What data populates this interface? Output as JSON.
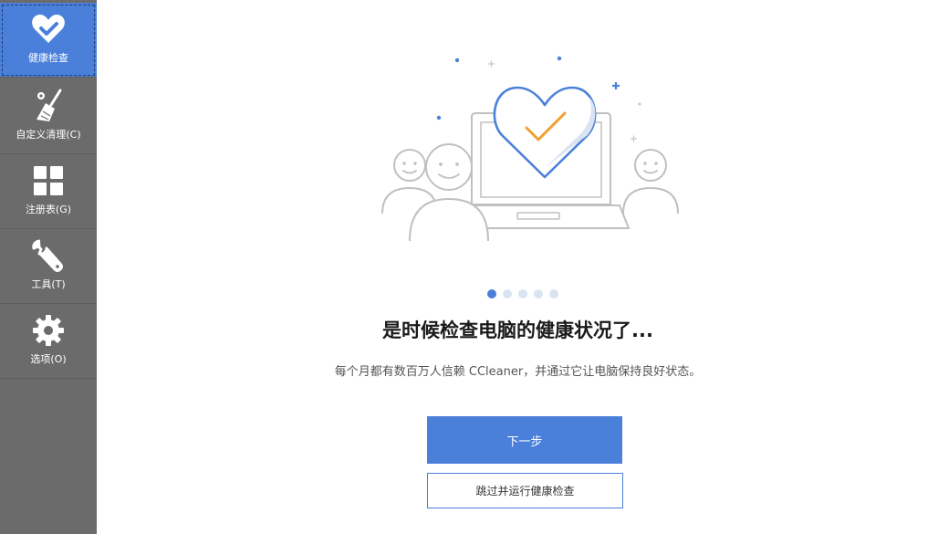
{
  "sidebar": {
    "items": [
      {
        "label": "健康检查",
        "icon": "heart-check-icon",
        "active": true
      },
      {
        "label": "自定义清理(C)",
        "icon": "broom-icon",
        "active": false
      },
      {
        "label": "注册表(G)",
        "icon": "grid-icon",
        "active": false
      },
      {
        "label": "工具(T)",
        "icon": "wrench-icon",
        "active": false
      },
      {
        "label": "选项(O)",
        "icon": "gear-icon",
        "active": false
      }
    ]
  },
  "main": {
    "carousel": {
      "total": 5,
      "current": 1
    },
    "headline": "是时候检查电脑的健康状况了...",
    "subtext": "每个月都有数百万人信赖 CCleaner，并通过它让电脑保持良好状态。",
    "primary_button": "下一步",
    "secondary_button": "跳过并运行健康检查"
  },
  "colors": {
    "sidebar_bg": "#6b6b6b",
    "accent": "#4a80da",
    "check_mark": "#f0a030"
  }
}
